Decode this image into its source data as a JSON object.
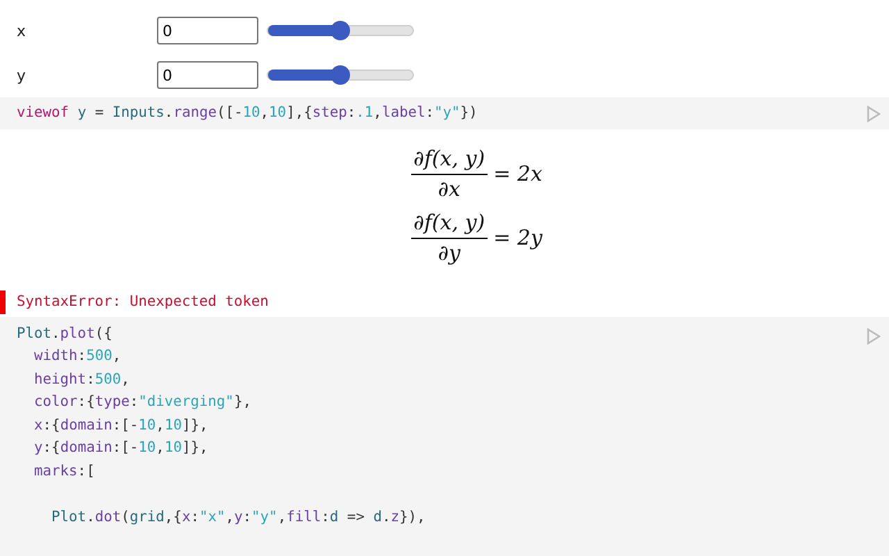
{
  "inputs": [
    {
      "label": "x",
      "value": "0",
      "level": 0.5
    },
    {
      "label": "y",
      "value": "0",
      "level": 0.5
    }
  ],
  "cell_1": {
    "lines": [
      {
        "text": "viewof y = Inputs.range([-10,10],{step:.1,label:\"y\"})"
      }
    ]
  },
  "equations": [
    {
      "numerator": "∂f(x, y)",
      "denominator": "∂x",
      "result": "= 2x"
    },
    {
      "numerator": "∂f(x, y)",
      "denominator": "∂y",
      "result": "= 2y"
    }
  ],
  "error": "SyntaxError: Unexpected token",
  "cell_2": {
    "lines": [
      {
        "text": "Plot.plot({"
      },
      {
        "text": "  width:500,"
      },
      {
        "text": "  height:500,"
      },
      {
        "text": "  color:{type:\"diverging\"},"
      },
      {
        "text": "  x:{domain:[-10,10]},"
      },
      {
        "text": "  y:{domain:[-10,10]},"
      },
      {
        "text": "  marks:["
      },
      {
        "text": "    Plot.dot(grid,{x:\"x\",y:\"y\",fill:d => d.z}),",
        "blank_before": true
      }
    ]
  }
}
